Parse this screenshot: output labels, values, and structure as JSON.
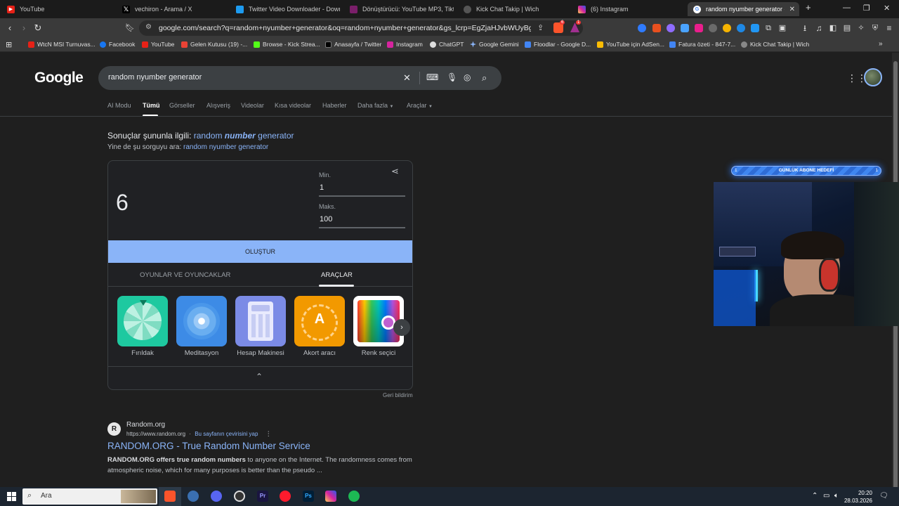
{
  "tabs": [
    {
      "title": "YouTube",
      "fav_color": "#e62117",
      "active": false
    },
    {
      "title": "vechiron - Arama / X",
      "fav_color": "#000000",
      "active": false
    },
    {
      "title": "Twitter Video Downloader - Downlo",
      "fav_color": "#1d9bf0",
      "active": false
    },
    {
      "title": "Dönüştürücü: YouTube MP3, Tiktok M",
      "fav_color": "#7a1f6a",
      "active": false
    },
    {
      "title": "Kick Chat Takip | Wich",
      "fav_color": "#555555",
      "active": false
    },
    {
      "title": "(6) Instagram",
      "fav_color": "#d6249f",
      "active": false
    },
    {
      "title": "random nyumber generator - G",
      "fav_color": "#ffffff",
      "active": true
    }
  ],
  "toolbar": {
    "url": "google.com/search?q=random+nyumber+generator&oq=random+nyumber+generator&gs_lcrp=EgZjaHJvbWUyBggAEEUYO...",
    "brave_badge": "6",
    "alert_badge": "1"
  },
  "bookmarks": [
    {
      "label": "WtcN MSI Turnuvas...",
      "color": "#e62117"
    },
    {
      "label": "Facebook",
      "color": "#1877f2"
    },
    {
      "label": "YouTube",
      "color": "#e62117"
    },
    {
      "label": "Gelen Kutusu (19) -...",
      "color": "#ea4335"
    },
    {
      "label": "Browse - Kick Strea...",
      "color": "#53fc18"
    },
    {
      "label": "Anasayfa / Twitter",
      "color": "#000000"
    },
    {
      "label": "Instagram",
      "color": "#d6249f"
    },
    {
      "label": "ChatGPT",
      "color": "#dddddd"
    },
    {
      "label": "Google Gemini",
      "color": "#8ab4f8"
    },
    {
      "label": "Floodlar - Google D...",
      "color": "#4285f4"
    },
    {
      "label": "YouTube için AdSen...",
      "color": "#fbbc04"
    },
    {
      "label": "Fatura özeti - 847-7...",
      "color": "#4285f4"
    },
    {
      "label": "Kick Chat Takip | Wich",
      "color": "#888888"
    }
  ],
  "google": {
    "logo": "Google",
    "query": "random nyumber generator",
    "nav_tabs": [
      "AI Modu",
      "Tümü",
      "Görseller",
      "Alışveriş",
      "Videolar",
      "Kısa videolar",
      "Haberler",
      "Daha fazla",
      "Araçlar"
    ],
    "spell": {
      "prefix": "Sonuçlar şununla ilgili:",
      "corr_a": "random",
      "corr_b": "number",
      "corr_c": "generator",
      "instead_prefix": "Yine de şu sorguyu ara:",
      "instead_link": "random nyumber generator"
    },
    "rng": {
      "result": "6",
      "min_label": "Min.",
      "min_value": "1",
      "max_label": "Maks.",
      "max_value": "100",
      "generate_label": "OLUŞTUR",
      "subtab_games": "OYUNLAR VE OYUNCAKLAR",
      "subtab_tools": "ARAÇLAR",
      "tools": [
        "Fırıldak",
        "Meditasyon",
        "Hesap Makinesi",
        "Akort aracı",
        "Renk seçici"
      ],
      "feedback": "Geri bildirim"
    },
    "result": {
      "favicon_letter": "R",
      "site": "Random.org",
      "url": "https://www.random.org",
      "translate": "Bu sayfanın çevirisini yap",
      "title": "RANDOM.ORG - True Random Number Service",
      "snippet_bold": "RANDOM.ORG offers true random numbers",
      "snippet_rest": "to anyone on the Internet. The randomness comes from atmospheric noise, which for many purposes is better than the pseudo ..."
    }
  },
  "overlay": {
    "goal_text": "GÜNLÜK ABONE HEDEFİ",
    "goal_left": "1",
    "goal_right": "1"
  },
  "taskbar": {
    "search_text": "Ara",
    "time": "20:20",
    "date": "28.03.2026"
  }
}
